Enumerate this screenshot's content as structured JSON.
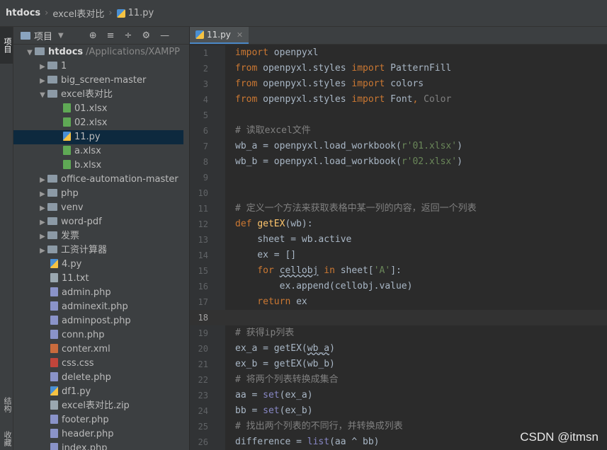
{
  "breadcrumb": {
    "root": "htdocs",
    "folder": "excel表对比",
    "file": "11.py"
  },
  "left_tabs": {
    "project": "项目",
    "structure": "结构",
    "favorites": "收藏"
  },
  "project_toolbar": {
    "label": "项目"
  },
  "tree": [
    {
      "label": "htdocs",
      "hint": "/Applications/XAMPP",
      "type": "folder",
      "expanded": true,
      "depth": 0
    },
    {
      "label": "1",
      "type": "folder",
      "depth": 1
    },
    {
      "label": "big_screen-master",
      "type": "folder",
      "depth": 1
    },
    {
      "label": "excel表对比",
      "type": "folder",
      "expanded": true,
      "depth": 1
    },
    {
      "label": "01.xlsx",
      "type": "xlsx",
      "depth": 2
    },
    {
      "label": "02.xlsx",
      "type": "xlsx",
      "depth": 2
    },
    {
      "label": "11.py",
      "type": "py",
      "depth": 2,
      "selected": true
    },
    {
      "label": "a.xlsx",
      "type": "xlsx",
      "depth": 2
    },
    {
      "label": "b.xlsx",
      "type": "xlsx",
      "depth": 2
    },
    {
      "label": "office-automation-master",
      "type": "folder",
      "depth": 1
    },
    {
      "label": "php",
      "type": "folder",
      "depth": 1
    },
    {
      "label": "venv",
      "type": "folder",
      "depth": 1
    },
    {
      "label": "word-pdf",
      "type": "folder",
      "depth": 1
    },
    {
      "label": "发票",
      "type": "folder",
      "depth": 1
    },
    {
      "label": "工资计算器",
      "type": "folder",
      "depth": 1
    },
    {
      "label": "4.py",
      "type": "py",
      "depth": 1
    },
    {
      "label": "11.txt",
      "type": "txt",
      "depth": 1
    },
    {
      "label": "admin.php",
      "type": "php",
      "depth": 1
    },
    {
      "label": "adminexit.php",
      "type": "php",
      "depth": 1
    },
    {
      "label": "adminpost.php",
      "type": "php",
      "depth": 1
    },
    {
      "label": "conn.php",
      "type": "php",
      "depth": 1
    },
    {
      "label": "conter.xml",
      "type": "xml",
      "depth": 1
    },
    {
      "label": "css.css",
      "type": "css",
      "depth": 1
    },
    {
      "label": "delete.php",
      "type": "php",
      "depth": 1
    },
    {
      "label": "df1.py",
      "type": "py",
      "depth": 1
    },
    {
      "label": "excel表对比.zip",
      "type": "zip",
      "depth": 1
    },
    {
      "label": "footer.php",
      "type": "php",
      "depth": 1
    },
    {
      "label": "header.php",
      "type": "php",
      "depth": 1
    },
    {
      "label": "index.php",
      "type": "php",
      "depth": 1
    }
  ],
  "editor": {
    "tab_label": "11.py",
    "current_line": 18,
    "lines": [
      [
        [
          "kw",
          "import"
        ],
        [
          "t",
          " openpyxl"
        ]
      ],
      [
        [
          "kw",
          "from"
        ],
        [
          "t",
          " openpyxl.styles "
        ],
        [
          "kw",
          "import"
        ],
        [
          "t",
          " PatternFill"
        ]
      ],
      [
        [
          "kw",
          "from"
        ],
        [
          "t",
          " openpyxl.styles "
        ],
        [
          "kw",
          "import"
        ],
        [
          "t",
          " colors"
        ]
      ],
      [
        [
          "kw",
          "from"
        ],
        [
          "t",
          " openpyxl.styles "
        ],
        [
          "kw",
          "import"
        ],
        [
          "t",
          " Font"
        ],
        [
          "kw",
          ","
        ],
        [
          "cm",
          " Color"
        ]
      ],
      [],
      [
        [
          "cm",
          "# 读取excel文件"
        ]
      ],
      [
        [
          "t",
          "wb_a = openpyxl.load_workbook("
        ],
        [
          "st",
          "r'01.xlsx'"
        ],
        [
          "t",
          ")"
        ]
      ],
      [
        [
          "t",
          "wb_b = openpyxl.load_workbook("
        ],
        [
          "st",
          "r'02.xlsx'"
        ],
        [
          "t",
          ")"
        ]
      ],
      [],
      [],
      [
        [
          "cm",
          "# 定义一个方法来获取表格中某一列的内容，返回一个列表"
        ]
      ],
      [
        [
          "kw",
          "def "
        ],
        [
          "fn",
          "getEX"
        ],
        [
          "t",
          "(wb):"
        ]
      ],
      [
        [
          "t",
          "    sheet = wb.active"
        ]
      ],
      [
        [
          "t",
          "    ex = []"
        ]
      ],
      [
        [
          "kw",
          "    for "
        ],
        [
          "sq",
          "cellobj"
        ],
        [
          "kw",
          " in"
        ],
        [
          "t",
          " sheet["
        ],
        [
          "st",
          "'A'"
        ],
        [
          "t",
          "]:"
        ]
      ],
      [
        [
          "t",
          "        ex.append(cellobj.value)"
        ]
      ],
      [
        [
          "kw",
          "    return"
        ],
        [
          "t",
          " ex"
        ]
      ],
      [],
      [
        [
          "cm",
          "# 获得ip列表"
        ]
      ],
      [
        [
          "t",
          "ex_a = getEX("
        ],
        [
          "sq",
          "wb_a"
        ],
        [
          "t",
          ")"
        ]
      ],
      [
        [
          "t",
          "ex_b = getEX(wb_b)"
        ]
      ],
      [
        [
          "cm",
          "# 将两个列表转换成集合"
        ]
      ],
      [
        [
          "t",
          "aa = "
        ],
        [
          "bi",
          "set"
        ],
        [
          "t",
          "(ex_a)"
        ]
      ],
      [
        [
          "t",
          "bb = "
        ],
        [
          "bi",
          "set"
        ],
        [
          "t",
          "(ex_b)"
        ]
      ],
      [
        [
          "cm",
          "# 找出两个列表的不同行，并转换成列表"
        ]
      ],
      [
        [
          "t",
          "difference = "
        ],
        [
          "bi",
          "list"
        ],
        [
          "t",
          "(aa ^ bb)"
        ]
      ]
    ]
  },
  "watermark": "CSDN @itmsn"
}
